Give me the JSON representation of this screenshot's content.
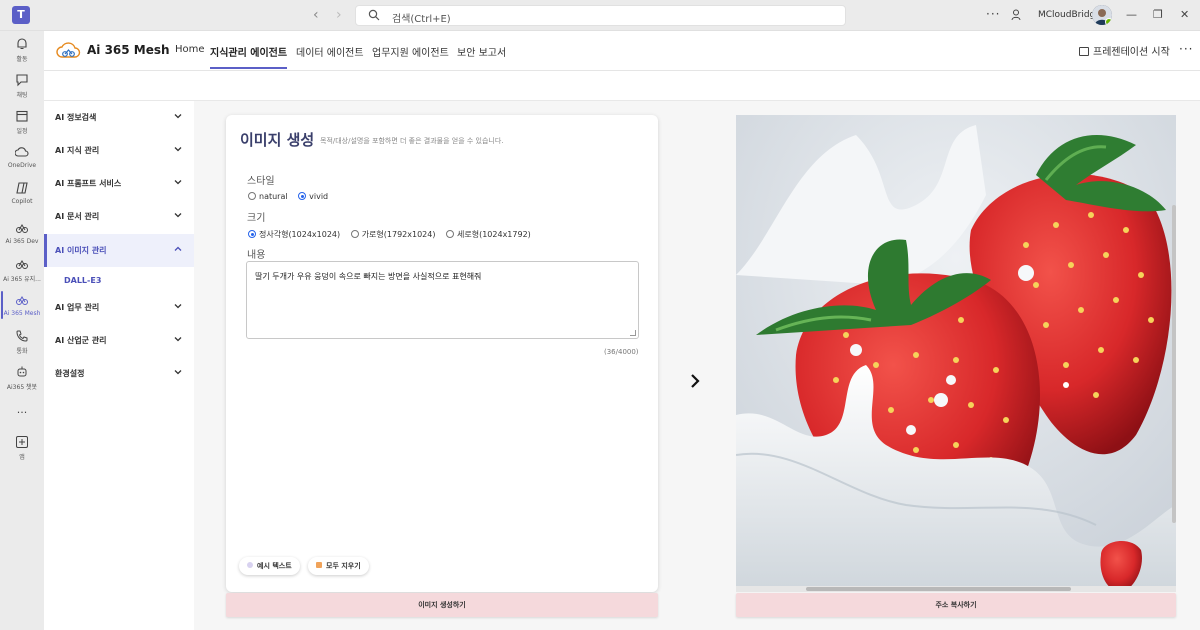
{
  "topbar": {
    "search_placeholder": "검색(Ctrl+E)",
    "org_name": "MCloudBridge",
    "more_icon": "more-horizontal-icon"
  },
  "rail": [
    {
      "label": "활동",
      "icon": "bell-icon"
    },
    {
      "label": "채팅",
      "icon": "chat-icon"
    },
    {
      "label": "일정",
      "icon": "calendar-icon"
    },
    {
      "label": "OneDrive",
      "icon": "cloud-icon"
    },
    {
      "label": "Copilot",
      "icon": "copilot-icon"
    },
    {
      "label": "Ai 365 Dev",
      "icon": "cloud-bike-icon"
    },
    {
      "label": "Ai 365 유지...",
      "icon": "cloud-bike-icon"
    },
    {
      "label": "Ai 365 Mesh",
      "icon": "cloud-bike-icon"
    },
    {
      "label": "통화",
      "icon": "phone-icon"
    },
    {
      "label": "Ai365 챗봇",
      "icon": "bot-icon"
    },
    {
      "label": "...",
      "icon": "more-icon"
    },
    {
      "label": "앱",
      "icon": "add-app-icon"
    }
  ],
  "app": {
    "brand": "Ai 365 Mesh",
    "menu": [
      "Home",
      "지식관리 에이전트",
      "데이터 에이전트",
      "업무지원 에이전트",
      "보안 보고서"
    ],
    "active_menu": "지식관리 에이전트",
    "present_label": "프레젠테이션 시작"
  },
  "sidebar": {
    "items": [
      {
        "label": "AI 정보검색"
      },
      {
        "label": "AI 지식 관리"
      },
      {
        "label": "AI 프롬프트 서비스"
      },
      {
        "label": "AI 문서 관리"
      },
      {
        "label": "AI 이미지 관리"
      },
      {
        "label": "AI 업무 관리"
      },
      {
        "label": "AI 산업군 관리"
      },
      {
        "label": "환경설정"
      }
    ],
    "sub_item": "DALL-E3"
  },
  "form": {
    "title": "이미지 생성",
    "description": "목적/대상/설명을 포함하면 더 좋은 결과물을 얻을 수 있습니다.",
    "style_label": "스타일",
    "style_options": [
      "natural",
      "vivid"
    ],
    "style_selected": "vivid",
    "size_label": "크기",
    "size_options": [
      "정사각형(1024x1024)",
      "가로형(1792x1024)",
      "세로형(1024x1792)"
    ],
    "size_selected": "정사각형(1024x1024)",
    "content_label": "내용",
    "content_value": "딸기 두개가 우유 웅덩이 속으로 빠지는 방면을 사실적으로 표현해줘",
    "counter": "(36/4000)",
    "example_button": "예시 텍스트",
    "clear_button": "모두 지우기",
    "generate_button": "이미지 생성하기"
  },
  "image_panel": {
    "copy_button": "주소 복사하기"
  },
  "colors": {
    "accent": "#5b5fc7",
    "action_button": "#f5d9dc",
    "strawberry": "#d8282a"
  }
}
